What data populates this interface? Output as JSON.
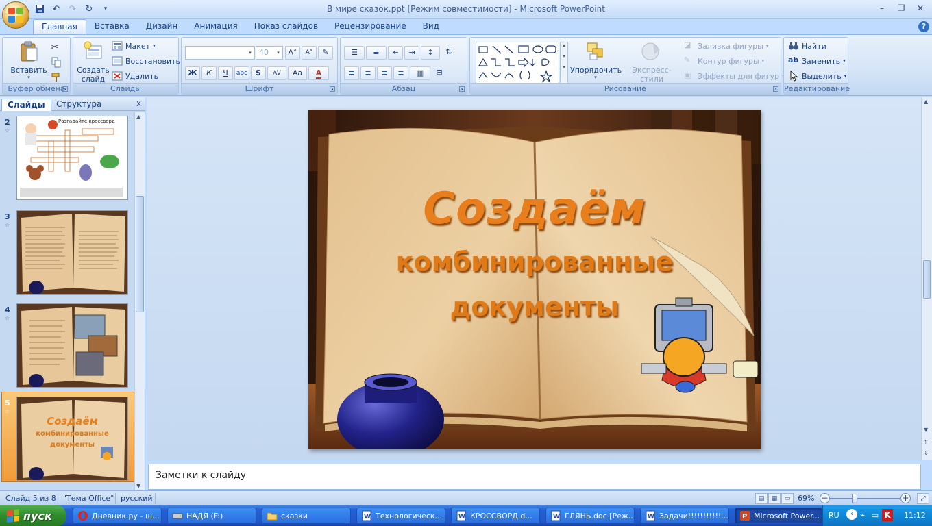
{
  "window": {
    "title": "В мире сказок.ppt [Режим совместимости] - Microsoft PowerPoint",
    "controls": [
      "–",
      "❐",
      "✕"
    ]
  },
  "ribbon_tabs": [
    "Главная",
    "Вставка",
    "Дизайн",
    "Анимация",
    "Показ слайдов",
    "Рецензирование",
    "Вид"
  ],
  "active_tab": "Главная",
  "groups": {
    "clipboard": {
      "label": "Буфер обмена",
      "paste": "Вставить"
    },
    "slides": {
      "label": "Слайды",
      "new_slide_line1": "Создать",
      "new_slide_line2": "слайд",
      "layout": "Макет",
      "reset": "Восстановить",
      "delete": "Удалить"
    },
    "font": {
      "label": "Шрифт",
      "font_size": "40",
      "bold": "Ж",
      "italic": "К",
      "underline": "Ч",
      "strike": "abc",
      "shadow": "S",
      "spacing": "AV",
      "case": "Aa",
      "color": "A",
      "grow": "A",
      "shrink": "A"
    },
    "paragraph": {
      "label": "Абзац"
    },
    "drawing": {
      "label": "Рисование",
      "arrange": "Упорядочить",
      "quick_styles": "Экспресс-стили",
      "fill": "Заливка фигуры",
      "outline": "Контур фигуры",
      "effects": "Эффекты для фигур"
    },
    "editing": {
      "label": "Редактирование",
      "find": "Найти",
      "replace": "Заменить",
      "select": "Выделить"
    }
  },
  "left_pane": {
    "tabs": [
      "Слайды",
      "Структура"
    ],
    "close": "x",
    "slides": [
      {
        "number": "2",
        "title": "Разгадайте кроссворд"
      },
      {
        "number": "3"
      },
      {
        "number": "4"
      },
      {
        "number": "5",
        "title1": "Создаём",
        "title2": "комбинированные",
        "title3": "документы",
        "selected": true
      }
    ]
  },
  "slide": {
    "title_line1": "Создаём",
    "title_line2": "комбинированные",
    "title_line3": "документы"
  },
  "notes": {
    "placeholder": "Заметки к слайду"
  },
  "status": {
    "slide_counter": "Слайд 5 из 8",
    "theme": "\"Тема Office\"",
    "language": "русский",
    "zoom": "69%"
  },
  "taskbar": {
    "start": "пуск",
    "tasks": [
      {
        "label": "Дневник.ру - ш...",
        "icon": "opera-icon"
      },
      {
        "label": "НАДЯ (F:)",
        "icon": "drive-icon"
      },
      {
        "label": "сказки",
        "icon": "folder-icon"
      },
      {
        "label": "Технологическ...",
        "icon": "word-icon"
      },
      {
        "label": "КРОССВОРД.d...",
        "icon": "word-icon"
      },
      {
        "label": "ГЛЯНЬ.doc [Реж...",
        "icon": "word-icon"
      },
      {
        "label": "Задачи!!!!!!!!!!!...",
        "icon": "word-icon"
      },
      {
        "label": "Microsoft Power...",
        "icon": "powerpoint-icon",
        "active": true
      }
    ],
    "lang": "RU",
    "time": "11:12"
  },
  "colors": {
    "accent": "#e87e1c",
    "ribbon": "#d5e4f7",
    "taskbar": "#2460d4",
    "start": "#2f8c2b"
  }
}
